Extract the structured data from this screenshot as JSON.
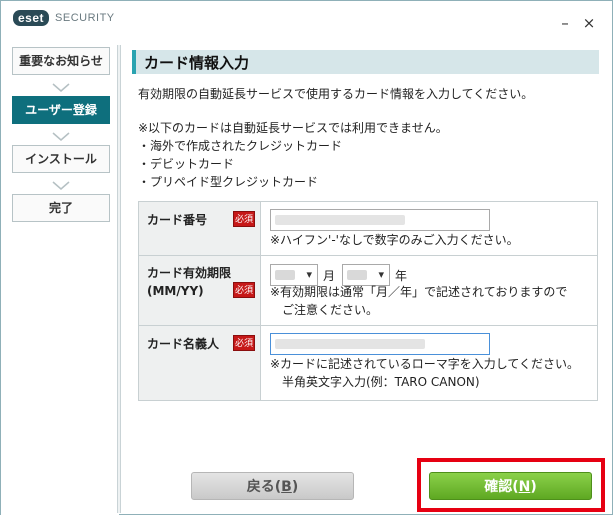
{
  "titlebar": {
    "logo_badge": "eset",
    "logo_text": "SECURITY",
    "minimize": "–",
    "close": "×"
  },
  "sidebar": {
    "steps": [
      {
        "label": "重要なお知らせ",
        "active": false
      },
      {
        "label": "ユーザー登録",
        "active": true
      },
      {
        "label": "インストール",
        "active": false
      },
      {
        "label": "完了",
        "active": false
      }
    ]
  },
  "main": {
    "title": "カード情報入力",
    "intro": "有効期限の自動延長サービスで使用するカード情報を入力してください。",
    "notes": [
      "※以下のカードは自動延長サービスでは利用できません。",
      "・海外で作成されたクレジットカード",
      "・デビットカード",
      "・プリペイド型クレジットカード"
    ]
  },
  "form": {
    "required_badge": "必須",
    "card_number": {
      "label": "カード番号",
      "hint": "※ハイフン'-'なしで数字のみご入力ください。"
    },
    "expiry": {
      "label_line1": "カード有効期限",
      "label_line2": "(MM/YY)",
      "month_unit": "月",
      "year_unit": "年",
      "hint_line1": "※有効期限は通常「月／年」で記述されておりますので",
      "hint_line2": "ご注意ください。"
    },
    "card_holder": {
      "label": "カード名義人",
      "hint_line1": "※カードに記述されているローマ字を入力してください。",
      "hint_line2": "半角英文字入力(例：TARO CANON)"
    }
  },
  "buttons": {
    "back_label": "戻る(",
    "back_key": "B",
    "back_close": ")",
    "ok_label": "確認(",
    "ok_key": "N",
    "ok_close": ")"
  },
  "colors": {
    "accent": "#0e6f7d",
    "header_bar": "#d6e6e9",
    "required": "#c61818",
    "confirm": "#5ea822",
    "highlight": "#e60012"
  }
}
